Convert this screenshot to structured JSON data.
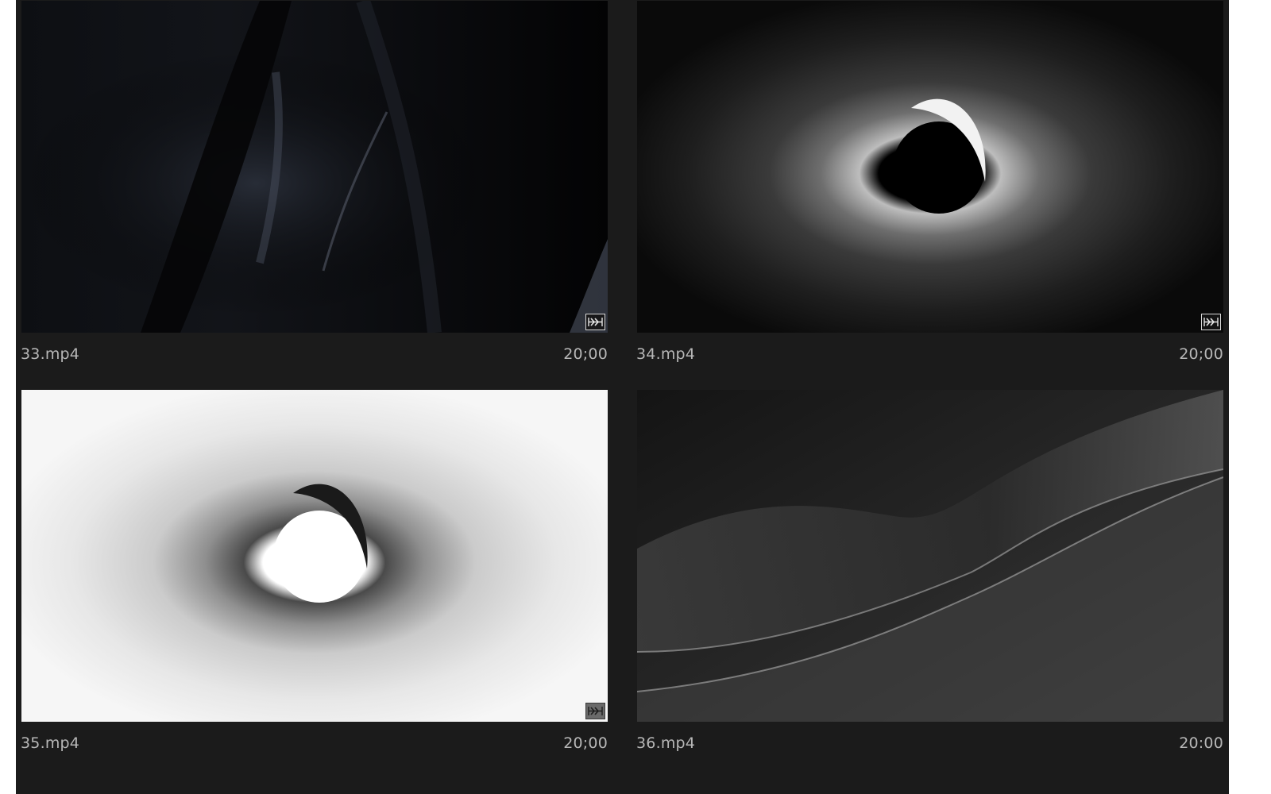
{
  "clips": [
    {
      "name": "33.mp4",
      "duration": "20;00",
      "has_badge": true,
      "badge_icon": "speed-ramp-icon"
    },
    {
      "name": "34.mp4",
      "duration": "20;00",
      "has_badge": true,
      "badge_icon": "speed-ramp-icon"
    },
    {
      "name": "35.mp4",
      "duration": "20;00",
      "has_badge": true,
      "badge_icon": "speed-ramp-icon"
    },
    {
      "name": "36.mp4",
      "duration": "20:00",
      "has_badge": false
    }
  ]
}
